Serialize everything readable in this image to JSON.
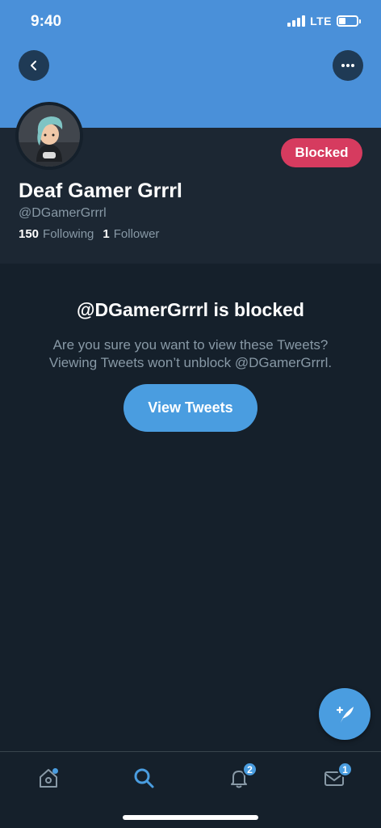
{
  "status_bar": {
    "time": "9:40",
    "network": "LTE"
  },
  "profile": {
    "display_name": "Deaf Gamer Grrrl",
    "handle": "@DGamerGrrrl",
    "following_count": "150",
    "following_label": "Following",
    "followers_count": "1",
    "followers_label": "Follower",
    "blocked_label": "Blocked"
  },
  "blocked_notice": {
    "title": "@DGamerGrrrl is blocked",
    "line1": "Are you sure you want to view these Tweets?",
    "line2": "Viewing Tweets won’t unblock @DGamerGrrrl.",
    "button_label": "View Tweets"
  },
  "tab_bar": {
    "tabs": [
      {
        "name": "home",
        "icon": "home-icon",
        "has_dot": true
      },
      {
        "name": "search",
        "icon": "search-icon",
        "active": true
      },
      {
        "name": "notifications",
        "icon": "bell-icon",
        "badge": "2"
      },
      {
        "name": "messages",
        "icon": "envelope-icon",
        "badge": "1"
      }
    ]
  },
  "colors": {
    "background": "#15202b",
    "banner": "#4a90d9",
    "accent": "#4a9de0",
    "blocked": "#d63b5f",
    "secondary_text": "#8899a6"
  }
}
